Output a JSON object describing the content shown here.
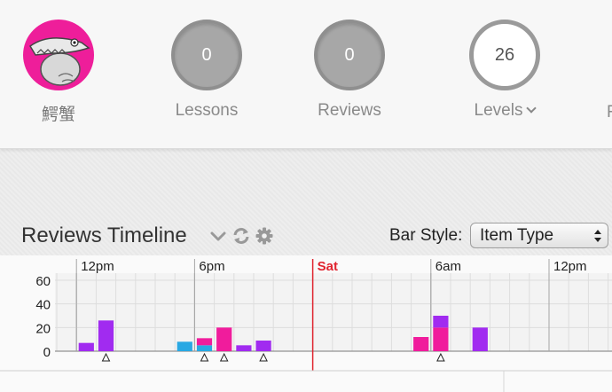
{
  "header": {
    "user": {
      "name": "鰐蟹"
    },
    "lessons": {
      "count": "0",
      "label": "Lessons"
    },
    "reviews": {
      "count": "0",
      "label": "Reviews"
    },
    "levels": {
      "count": "26",
      "label": "Levels"
    },
    "next_label_clipped": "F"
  },
  "timeline": {
    "title": "Reviews Timeline",
    "bar_style_label": "Bar Style:",
    "bar_style_value": "Item Type",
    "colors": {
      "radical": "#29a8e3",
      "kanji": "#f01c9c",
      "vocab": "#a12bf0",
      "now_line": "#e0242f"
    },
    "icons": [
      "chevron-down-icon",
      "refresh-icon",
      "gear-icon"
    ]
  },
  "chart_data": {
    "type": "bar",
    "stacked": true,
    "x_tick_labels": [
      "12pm",
      "6pm",
      "Sat",
      "6am",
      "12pm"
    ],
    "now_label": "Sat",
    "y_ticks": [
      0,
      20,
      40,
      60
    ],
    "ylim": [
      0,
      65
    ],
    "hours": [
      1,
      2,
      6,
      7,
      8,
      9,
      10,
      18,
      19,
      21
    ],
    "series": [
      {
        "name": "radical",
        "values": [
          0,
          0,
          8,
          5,
          0,
          0,
          0,
          0,
          0,
          0
        ]
      },
      {
        "name": "kanji",
        "values": [
          0,
          0,
          0,
          6,
          20,
          0,
          0,
          12,
          20,
          0
        ]
      },
      {
        "name": "vocab",
        "values": [
          7,
          26,
          0,
          0,
          0,
          5,
          9,
          0,
          10,
          20
        ]
      }
    ],
    "markers": [
      2,
      7,
      8,
      10,
      19
    ],
    "grid": true
  }
}
